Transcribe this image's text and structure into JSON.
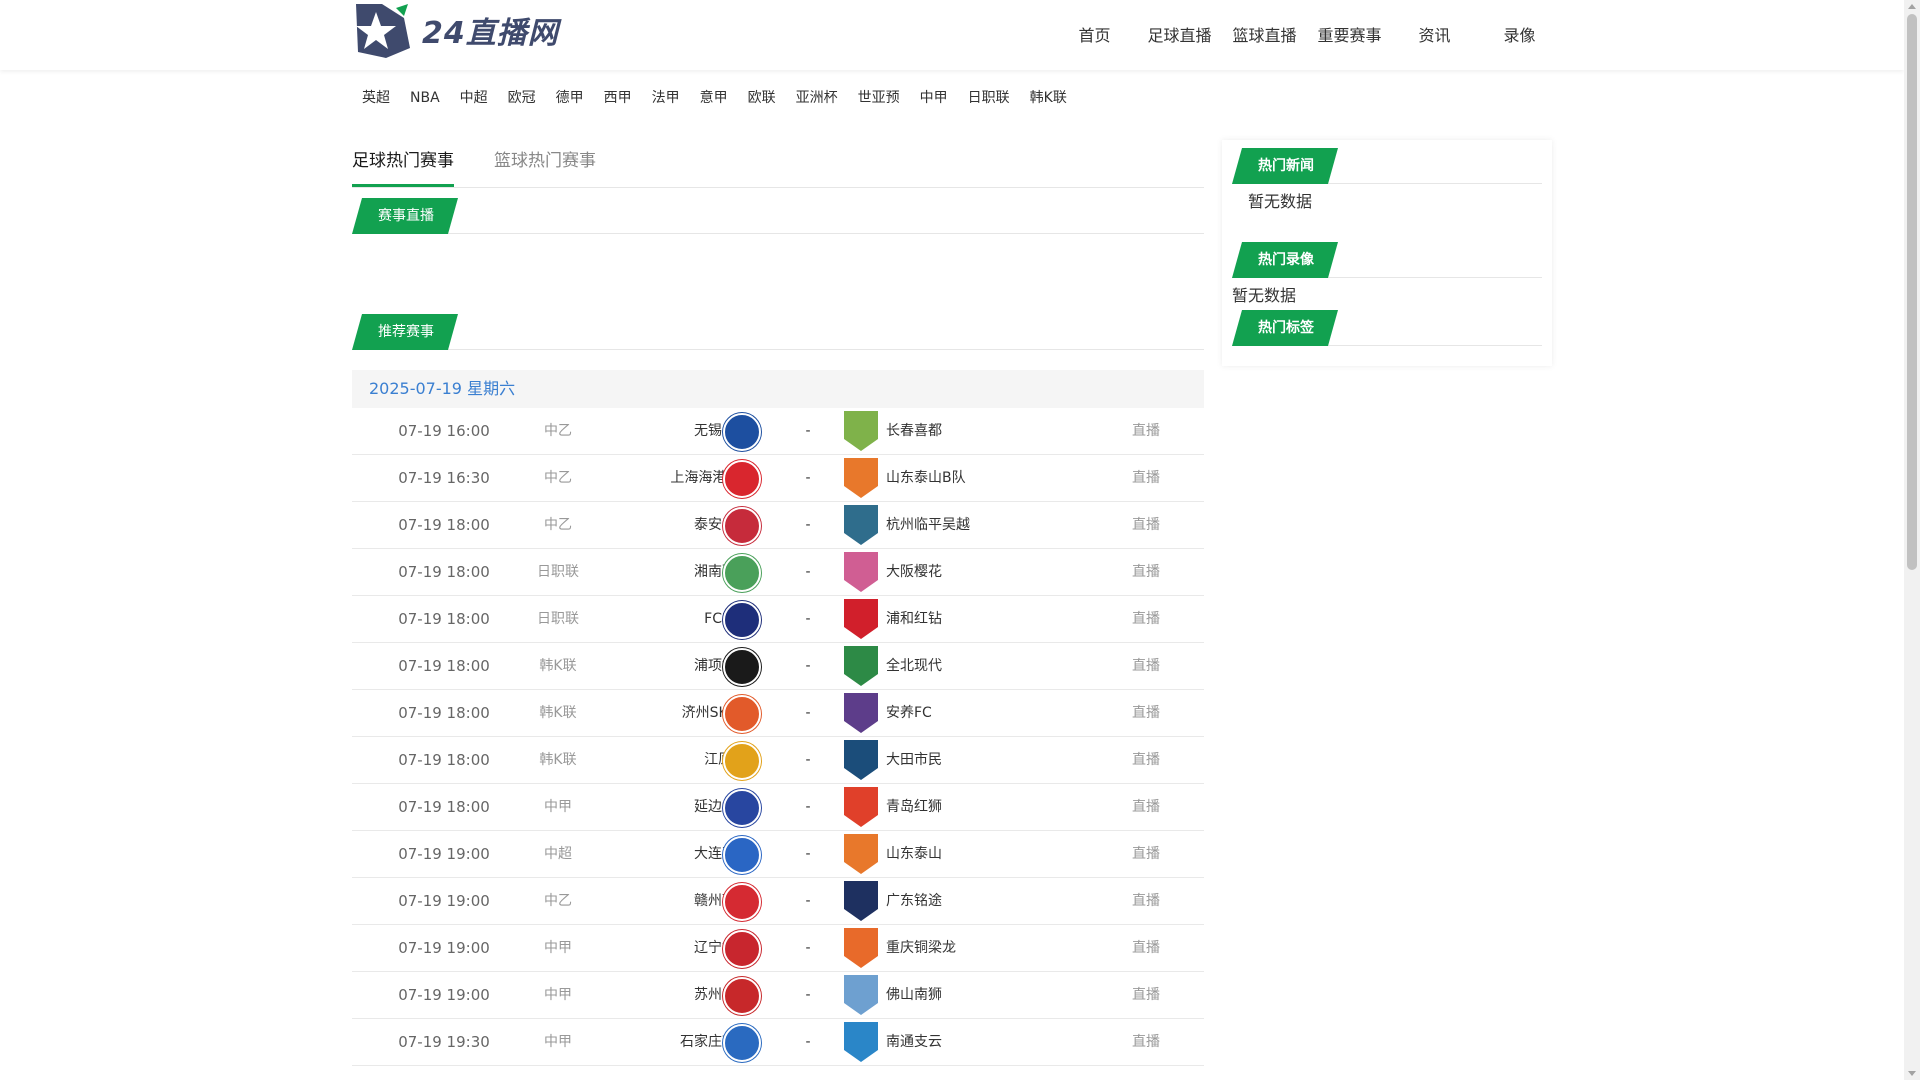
{
  "header": {
    "logo_text": "24直播网",
    "nav": [
      "首页",
      "足球直播",
      "篮球直播",
      "重要赛事",
      "资讯",
      "录像"
    ]
  },
  "subnav": [
    "英超",
    "NBA",
    "中超",
    "欧冠",
    "德甲",
    "西甲",
    "法甲",
    "意甲",
    "欧联",
    "亚洲杯",
    "世亚预",
    "中甲",
    "日职联",
    "韩K联"
  ],
  "tabs": [
    "足球热门赛事",
    "篮球热门赛事"
  ],
  "sections": {
    "live": "赛事直播",
    "recommended": "推荐赛事"
  },
  "date_label": "2025-07-19 星期六",
  "matches": [
    {
      "time": "07-19 16:00",
      "league": "中乙",
      "home": "无锡吴钩",
      "away": "长春喜都",
      "vs": "-",
      "live": "直播",
      "hcolor": "#1d4fa0",
      "acolor": "#7fb24a"
    },
    {
      "time": "07-19 16:30",
      "league": "中乙",
      "home": "上海海港B队",
      "away": "山东泰山B队",
      "vs": "-",
      "live": "直播",
      "hcolor": "#d9262e",
      "acolor": "#e8782b"
    },
    {
      "time": "07-19 18:00",
      "league": "中乙",
      "home": "泰安天贶",
      "away": "杭州临平吴越",
      "vs": "-",
      "live": "直播",
      "hcolor": "#c62b3b",
      "acolor": "#2f6d8c"
    },
    {
      "time": "07-19 18:00",
      "league": "日职联",
      "home": "湘南丽海",
      "away": "大阪樱花",
      "vs": "-",
      "live": "直播",
      "hcolor": "#4aa05a",
      "acolor": "#d05e93"
    },
    {
      "time": "07-19 18:00",
      "league": "日职联",
      "home": "FC东京",
      "away": "浦和红钻",
      "vs": "-",
      "live": "直播",
      "hcolor": "#1e2e7a",
      "acolor": "#d11f2b"
    },
    {
      "time": "07-19 18:00",
      "league": "韩K联",
      "home": "浦项铁人",
      "away": "全北现代",
      "vs": "-",
      "live": "直播",
      "hcolor": "#1a1a1a",
      "acolor": "#2d8a46"
    },
    {
      "time": "07-19 18:00",
      "league": "韩K联",
      "home": "济州SK FC",
      "away": "安养FC",
      "vs": "-",
      "live": "直播",
      "hcolor": "#e25a2a",
      "acolor": "#5d3d8a"
    },
    {
      "time": "07-19 18:00",
      "league": "韩K联",
      "home": "江原FC",
      "away": "大田市民",
      "vs": "-",
      "live": "直播",
      "hcolor": "#e2a21a",
      "acolor": "#1b4d7a"
    },
    {
      "time": "07-19 18:00",
      "league": "中甲",
      "home": "延边龙鼎",
      "away": "青岛红狮",
      "vs": "-",
      "live": "直播",
      "hcolor": "#2846a0",
      "acolor": "#e0402a"
    },
    {
      "time": "07-19 19:00",
      "league": "中超",
      "home": "大连英博",
      "away": "山东泰山",
      "vs": "-",
      "live": "直播",
      "hcolor": "#2a66c4",
      "acolor": "#e8782b"
    },
    {
      "time": "07-19 19:00",
      "league": "中乙",
      "home": "赣州瑞狮",
      "away": "广东铭途",
      "vs": "-",
      "live": "直播",
      "hcolor": "#d52a32",
      "acolor": "#1e3060"
    },
    {
      "time": "07-19 19:00",
      "league": "中甲",
      "home": "辽宁铁人",
      "away": "重庆铜梁龙",
      "vs": "-",
      "live": "直播",
      "hcolor": "#c8262e",
      "acolor": "#e86a2a"
    },
    {
      "time": "07-19 19:00",
      "league": "中甲",
      "home": "苏州东吴",
      "away": "佛山南狮",
      "vs": "-",
      "live": "直播",
      "hcolor": "#c7282a",
      "acolor": "#6ea0d0"
    },
    {
      "time": "07-19 19:30",
      "league": "中甲",
      "home": "石家庄功夫",
      "away": "南通支云",
      "vs": "-",
      "live": "直播",
      "hcolor": "#2a6ac0",
      "acolor": "#2a86c8"
    }
  ],
  "sidebar": {
    "news_title": "热门新闻",
    "news_empty": "暂无数据",
    "video_title": "热门录像",
    "video_empty": "暂无数据",
    "tags_title": "热门标签"
  },
  "colors": {
    "accent": "#12a150",
    "date": "#3a7fd1"
  }
}
